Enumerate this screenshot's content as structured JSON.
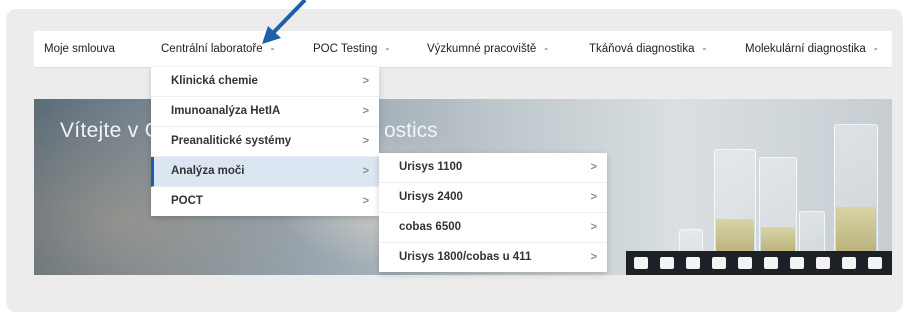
{
  "colors": {
    "frame_bg": "#ececec",
    "navbar_bg": "#ffffff",
    "accent_arrow": "#1d5fa8",
    "menu_active_bg": "#dbe6f2",
    "menu_active_border": "#1d5fa8"
  },
  "navbar": {
    "items": [
      {
        "label": "Moje smlouva",
        "caret": ""
      },
      {
        "label": "Centrální laboratoře",
        "caret": "-"
      },
      {
        "label": "POC Testing",
        "caret": "-"
      },
      {
        "label": "Výzkumné pracoviště",
        "caret": "-"
      },
      {
        "label": "Tkáňová diagnostika",
        "caret": "-"
      },
      {
        "label": "Molekulární diagnostika",
        "caret": "-"
      }
    ]
  },
  "hero": {
    "title_left": "Vítejte v O",
    "title_right": "ostics"
  },
  "dropdown": {
    "items": [
      {
        "label": "Klinická chemie",
        "chevron": ">"
      },
      {
        "label": "Imunoanalýza HetIA",
        "chevron": ">"
      },
      {
        "label": "Preanalitické systémy",
        "chevron": ">"
      },
      {
        "label": "Analýza moči",
        "chevron": ">"
      },
      {
        "label": "POCT",
        "chevron": ">"
      }
    ]
  },
  "submenu": {
    "items": [
      {
        "label": "Urisys 1100",
        "chevron": ">"
      },
      {
        "label": "Urisys 2400",
        "chevron": ">"
      },
      {
        "label": "cobas 6500",
        "chevron": ">"
      },
      {
        "label": "Urisys 1800/cobas u 411",
        "chevron": ">"
      }
    ]
  },
  "annotation": {
    "icon": "arrow-pointer-icon"
  }
}
